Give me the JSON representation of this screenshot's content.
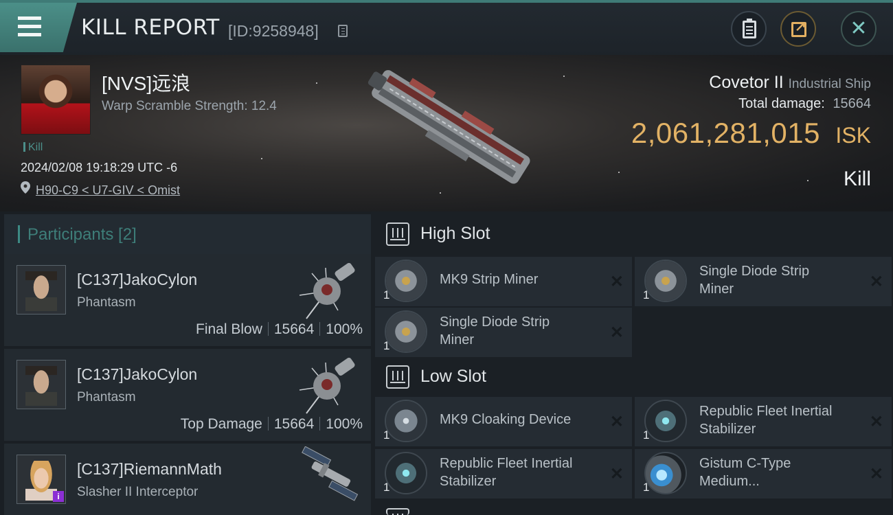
{
  "header": {
    "title": "KILL REPORT",
    "report_id": "[ID:9258948]"
  },
  "victim": {
    "name": "[NVS]远浪",
    "warp_scramble": "Warp Scramble Strength: 12.4",
    "tag": "Kill",
    "datetime": "2024/02/08 19:18:29 UTC -6",
    "location": "H90-C9 < U7-GIV < Omist"
  },
  "ship": {
    "name": "Covetor II",
    "class": "Industrial Ship",
    "total_damage_label": "Total damage:",
    "total_damage_value": "15664",
    "isk_value": "2,061,281,015",
    "isk_unit": "ISK",
    "result": "Kill"
  },
  "participants": {
    "title": "Participants [2]",
    "list": [
      {
        "name": "[C137]JakoCylon",
        "ship": "Phantasm",
        "role": "Final Blow",
        "damage": "15664",
        "percent": "100%"
      },
      {
        "name": "[C137]JakoCylon",
        "ship": "Phantasm",
        "role": "Top Damage",
        "damage": "15664",
        "percent": "100%"
      },
      {
        "name": "[C137]RiemannMath",
        "ship": "Slasher II Interceptor",
        "badge": "i"
      }
    ]
  },
  "fitting": {
    "high_slot": {
      "title": "High Slot",
      "items": [
        {
          "qty": "1",
          "name_l1": "MK9 Strip Miner",
          "name_l2": ""
        },
        {
          "qty": "1",
          "name_l1": "Single Diode Strip",
          "name_l2": "Miner"
        },
        {
          "qty": "1",
          "name_l1": "Single Diode Strip",
          "name_l2": "Miner"
        }
      ]
    },
    "low_slot": {
      "title": "Low Slot",
      "items": [
        {
          "qty": "1",
          "name_l1": "MK9 Cloaking Device",
          "name_l2": ""
        },
        {
          "qty": "1",
          "name_l1": "Republic Fleet Inertial",
          "name_l2": "Stabilizer"
        },
        {
          "qty": "1",
          "name_l1": "Republic Fleet Inertial",
          "name_l2": "Stabilizer"
        },
        {
          "qty": "1",
          "name_l1": "Gistum C-Type",
          "name_l2": "Medium..."
        }
      ]
    },
    "remove_glyph": "✕"
  },
  "icons": {
    "menu": "hamburger-menu-icon",
    "copy": "copy-icon",
    "clipboard": "clipboard-icon",
    "share": "share-icon",
    "close": "close-icon",
    "location": "location-pin-icon",
    "slot": "slot-icon"
  },
  "colors": {
    "accent_teal": "#3f7b77",
    "isk_gold": "#e2b265",
    "background": "#15191e",
    "card": "#232a30"
  }
}
